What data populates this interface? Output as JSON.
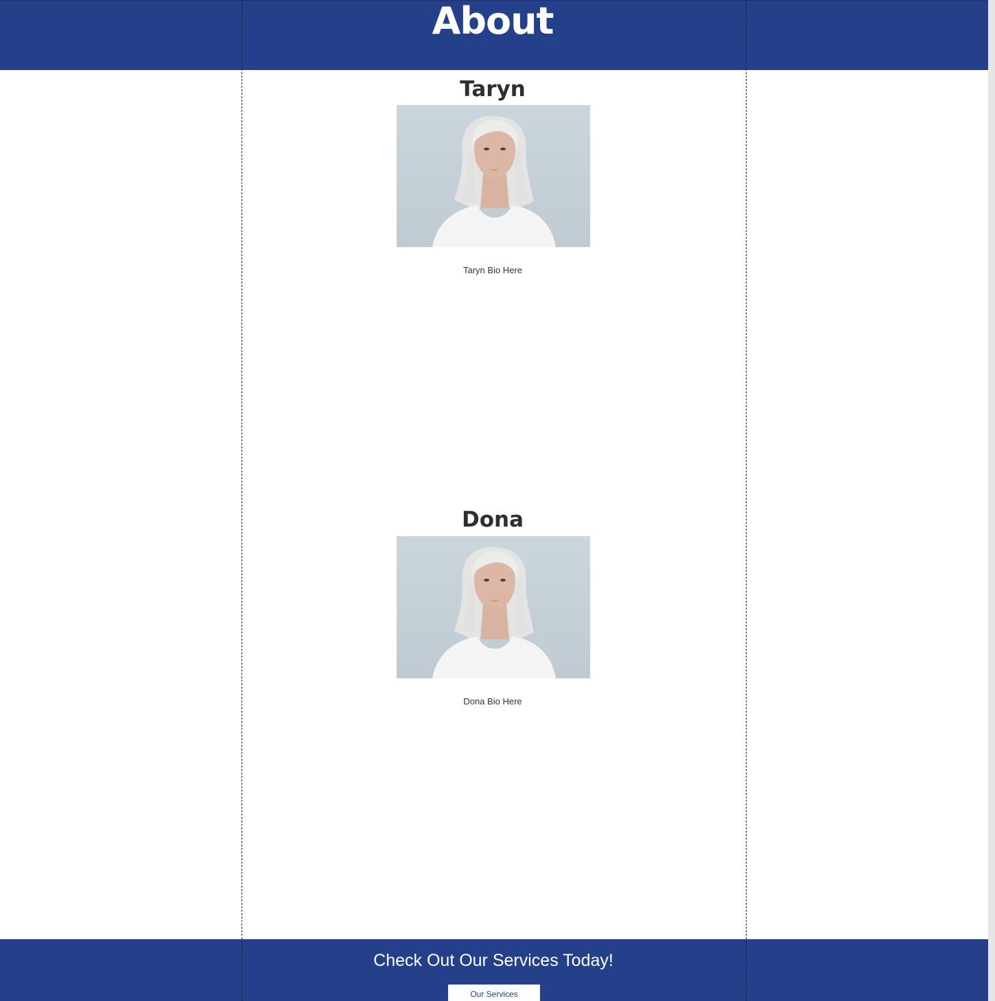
{
  "header": {
    "title": "About"
  },
  "team": [
    {
      "name": "Taryn",
      "bio": "Taryn Bio Here",
      "photo_icon": "portrait-photo"
    },
    {
      "name": "Dona",
      "bio": "Dona Bio Here",
      "photo_icon": "portrait-photo"
    }
  ],
  "footer": {
    "cta_text": "Check Out Our Services Today!",
    "button_label": "Our Services"
  },
  "colors": {
    "brand_blue": "#24408b",
    "text_dark": "#2e2e2e",
    "background": "#ffffff"
  }
}
